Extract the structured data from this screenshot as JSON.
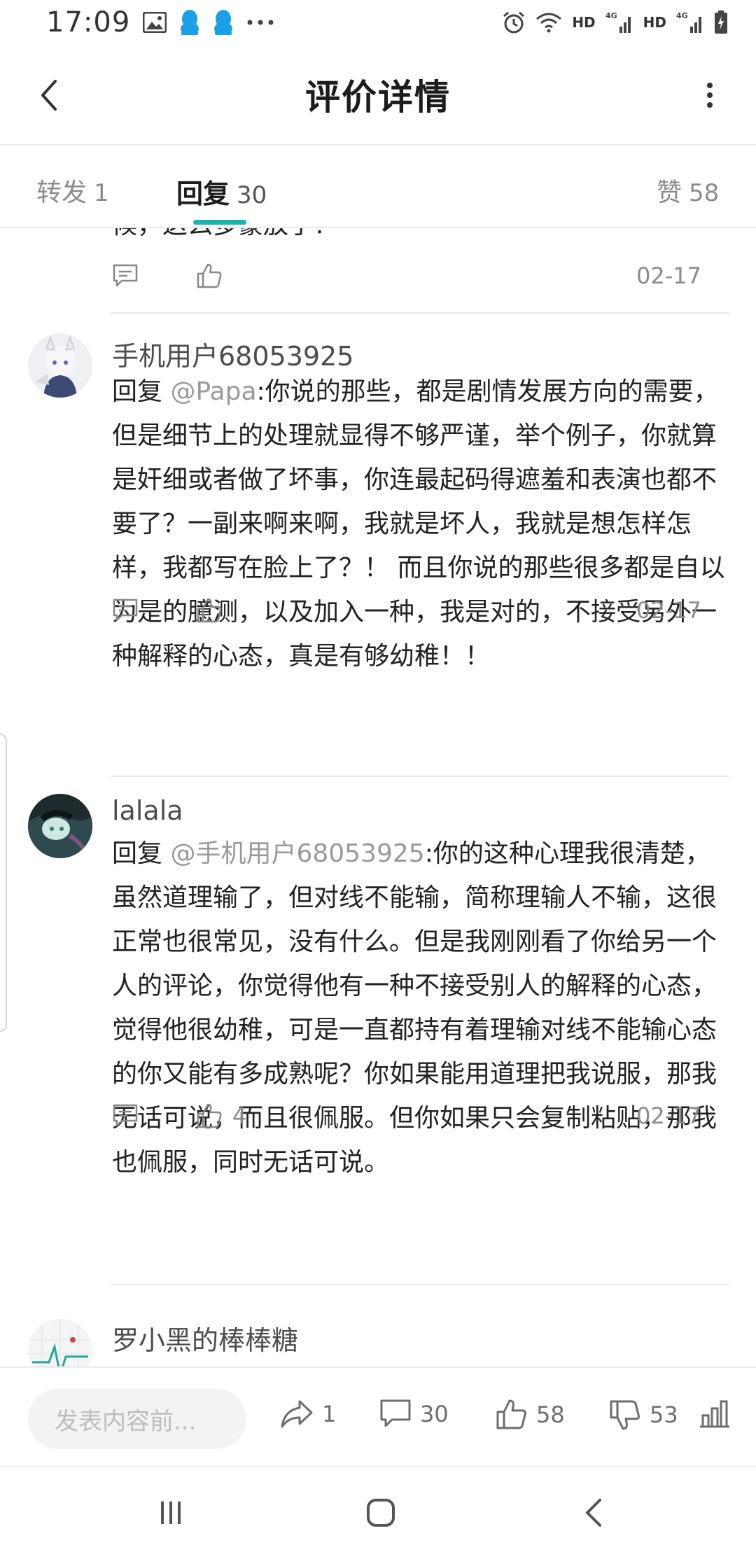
{
  "status_bar": {
    "time": "17:09",
    "left_icons": [
      "image-icon",
      "qq-penguin-icon",
      "qq-penguin-icon",
      "more-dots-icon"
    ],
    "right_icons": [
      "alarm-icon",
      "wifi-icon",
      "hd-4g-signal-icon",
      "hd-4g-signal-icon",
      "battery-charging-icon"
    ],
    "hd_label": "HD",
    "net_label": "4G"
  },
  "header": {
    "title": "评价详情"
  },
  "tabs": [
    {
      "label": "转发",
      "count": "1"
    },
    {
      "label": "回复",
      "count": "30"
    },
    {
      "label": "赞",
      "count": "58"
    }
  ],
  "feed": {
    "clipped_text": "候，这么多豪放了？",
    "first_actions": {
      "date": "02-17"
    },
    "comments": [
      {
        "username": "手机用户68053925",
        "reply_prefix": "回复 ",
        "mention": "@Papa",
        "text": ":你说的那些，都是剧情发展方向的需要，但是细节上的处理就显得不够严谨，举个例子，你就算是奸细或者做了坏事，你连最起码得遮羞和表演也都不要了？一副来啊来啊，我就是坏人，我就是想怎样怎样，我都写在脸上了？！ 而且你说的那些很多都是自以为是的臆测，以及加入一种，我是对的，不接受另外一种解释的心态，真是有够幼稚！！",
        "likes": "",
        "date": "02-17"
      },
      {
        "username": "lalala",
        "reply_prefix": "回复 ",
        "mention": "@手机用户68053925",
        "text": ":你的这种心理我很清楚，虽然道理输了，但对线不能输，简称理输人不输，这很正常也很常见，没有什么。但是我刚刚看了你给另一个人的评论，你觉得他有一种不接受别人的解释的心态，觉得他很幼稚，可是一直都持有着理输对线不能输心态的你又能有多成熟呢？你如果能用道理把我说服，那我无话可说，而且很佩服。但你如果只会复制粘贴，那我也佩服，同时无话可说。",
        "likes": "4",
        "date": "02-17"
      },
      {
        "username": "罗小黑的棒棒糖"
      }
    ]
  },
  "bottom_bar": {
    "placeholder": "发表内容前...",
    "share_count": "1",
    "comment_count": "30",
    "like_count": "58",
    "dislike_count": "53"
  },
  "colors": {
    "accent": "#17b6b5",
    "text_primary": "#222222",
    "text_secondary": "#8c8c8c",
    "divider": "#e8e8e8"
  }
}
